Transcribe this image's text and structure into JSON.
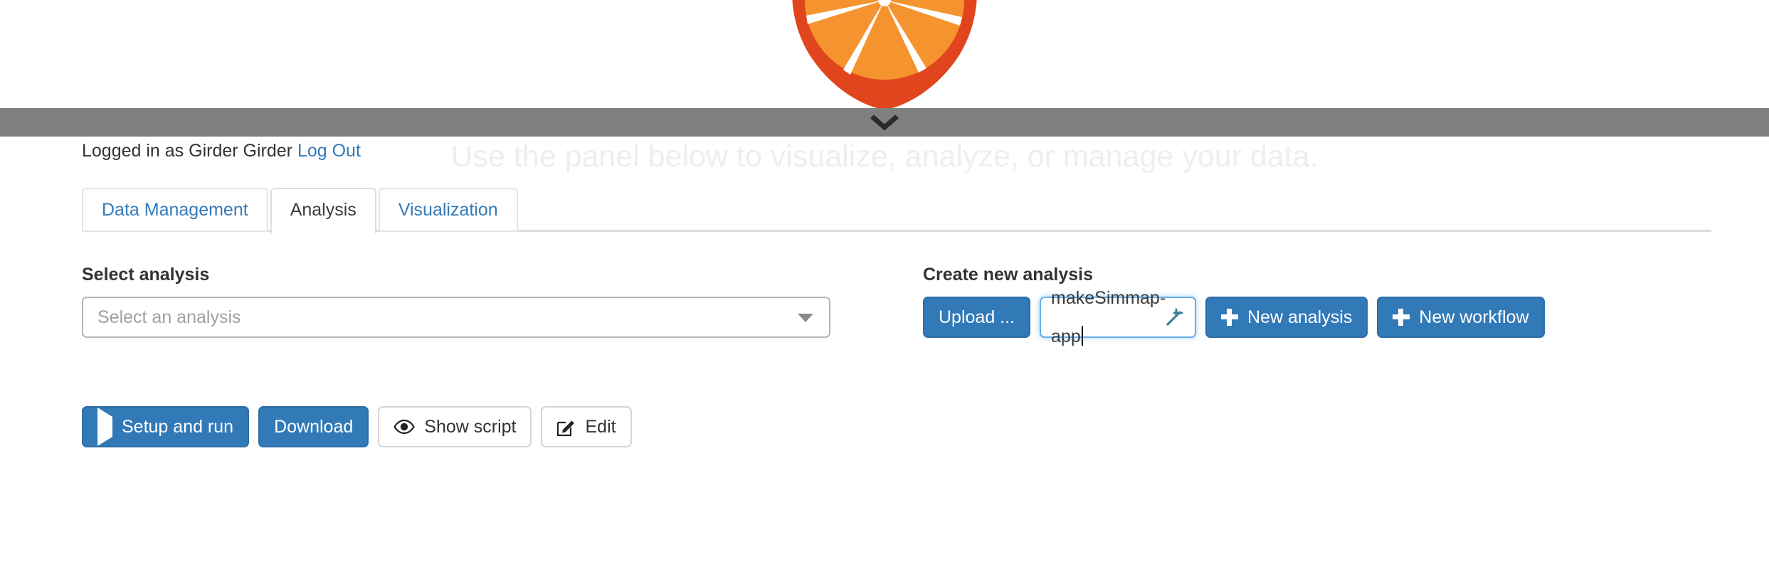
{
  "brand": {
    "logo_icon": "orange-slice-logo",
    "orange_color": "#F5942E",
    "red_color": "#E1451E",
    "collapse_icon": "chevron-down-icon"
  },
  "banner": {
    "tagline": "Use the panel below to visualize, analyze, or manage your data."
  },
  "account": {
    "status_text": "Logged in as Girder Girder",
    "logout_label": "Log Out"
  },
  "tabs": [
    {
      "label": "Data Management",
      "active": false
    },
    {
      "label": "Analysis",
      "active": true
    },
    {
      "label": "Visualization",
      "active": false
    }
  ],
  "select_analysis": {
    "heading": "Select analysis",
    "placeholder": "Select an analysis",
    "value": "",
    "caret_icon": "caret-down-icon"
  },
  "create_analysis": {
    "heading": "Create new analysis",
    "upload_label": "Upload ...",
    "name_value": "makeSimmap-app",
    "wand_icon": "magic-wand-icon",
    "new_analysis_label": "New analysis",
    "new_workflow_label": "New workflow",
    "plus_icon": "plus-icon"
  },
  "actions": {
    "setup_and_run_label": "Setup and run",
    "play_icon": "play-icon",
    "download_label": "Download",
    "show_script_label": "Show script",
    "eye_icon": "eye-icon",
    "edit_label": "Edit",
    "pencil_square_icon": "pencil-square-icon"
  },
  "theme": {
    "primary": "#3279b7",
    "link": "#337ab7",
    "bar_gray": "#808080",
    "focus_blue": "#66afe9"
  }
}
